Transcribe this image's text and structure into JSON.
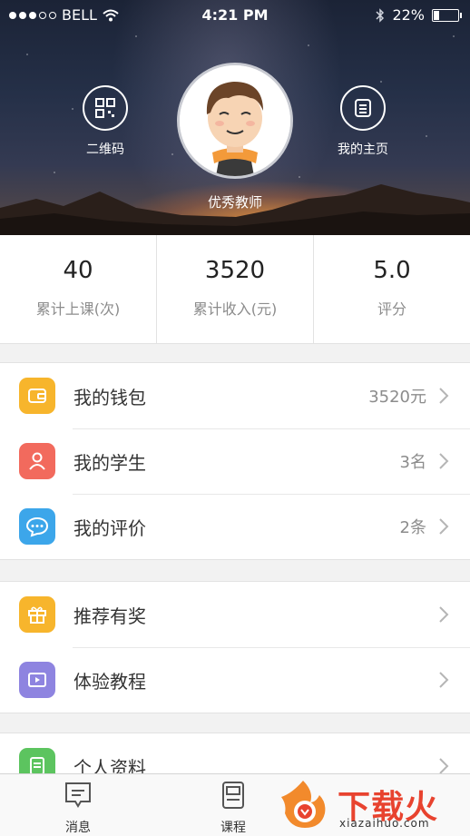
{
  "status_bar": {
    "carrier": "BELL",
    "time": "4:21 PM",
    "battery": "22%"
  },
  "header": {
    "qr_label": "二维码",
    "home_label": "我的主页",
    "name": "优秀教师"
  },
  "stats": [
    {
      "value": "40",
      "label": "累计上课(次)"
    },
    {
      "value": "3520",
      "label": "累计收入(元)"
    },
    {
      "value": "5.0",
      "label": "评分"
    }
  ],
  "menu_group_1": [
    {
      "label": "我的钱包",
      "value": "3520元",
      "icon": "wallet-icon",
      "color": "#f7b52c"
    },
    {
      "label": "我的学生",
      "value": "3名",
      "icon": "person-icon",
      "color": "#f26a5d"
    },
    {
      "label": "我的评价",
      "value": "2条",
      "icon": "chat-icon",
      "color": "#3ca6ea"
    }
  ],
  "menu_group_2": [
    {
      "label": "推荐有奖",
      "value": "",
      "icon": "gift-icon",
      "color": "#f7b52c"
    },
    {
      "label": "体验教程",
      "value": "",
      "icon": "video-icon",
      "color": "#8e84e0"
    }
  ],
  "menu_group_3": [
    {
      "label": "个人资料",
      "value": "",
      "icon": "document-icon",
      "color": "#5cc45f"
    }
  ],
  "tabbar": {
    "messages": "消息",
    "courses": "课程"
  },
  "watermark": {
    "text": "下载火",
    "sub": "xiazaihuo.com"
  }
}
